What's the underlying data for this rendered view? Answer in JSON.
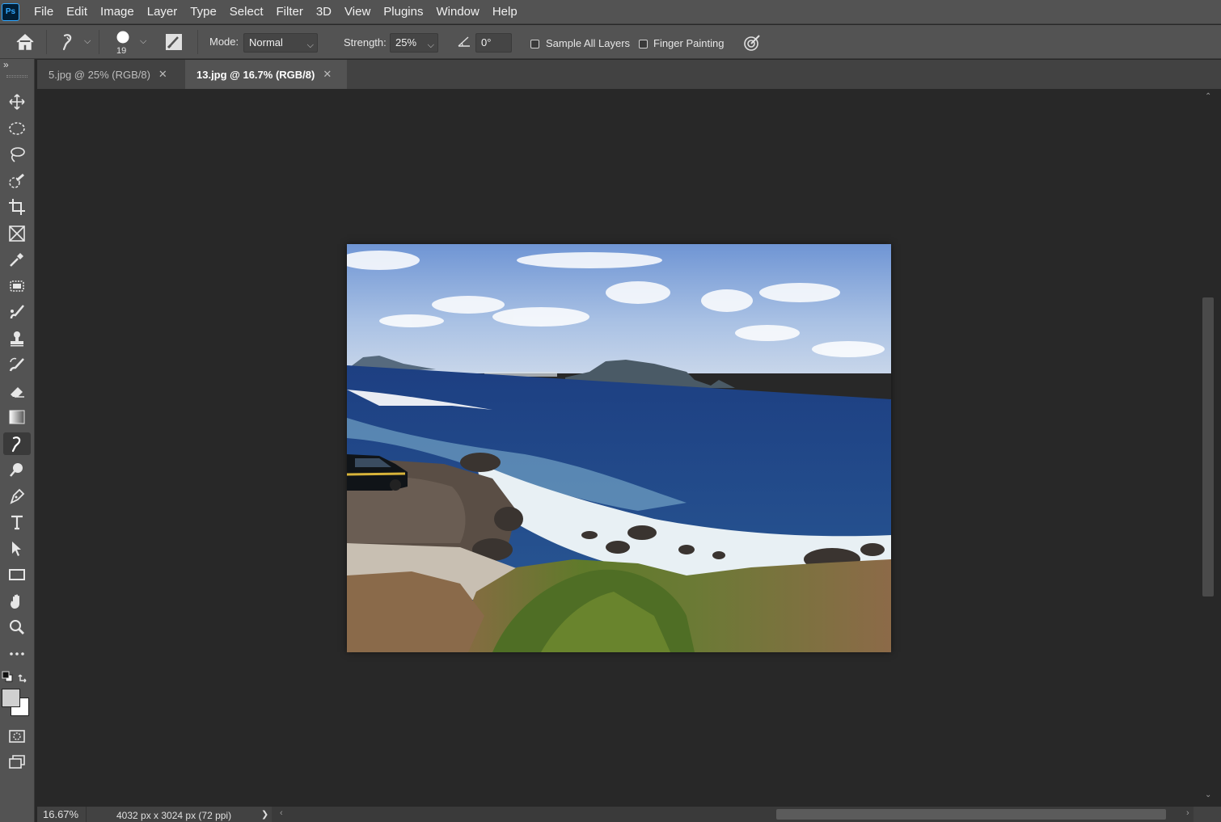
{
  "app": {
    "logo_text": "Ps"
  },
  "menu": [
    "File",
    "Edit",
    "Image",
    "Layer",
    "Type",
    "Select",
    "Filter",
    "3D",
    "View",
    "Plugins",
    "Window",
    "Help"
  ],
  "options": {
    "brush_size": "19",
    "mode_label": "Mode:",
    "mode_value": "Normal",
    "strength_label": "Strength:",
    "strength_value": "25%",
    "angle_value": "0°",
    "sample_all_layers": "Sample All Layers",
    "finger_painting": "Finger Painting"
  },
  "tabs": [
    {
      "label": "5.jpg @ 25% (RGB/8)",
      "active": false
    },
    {
      "label": "13.jpg @ 16.7% (RGB/8)",
      "active": true
    }
  ],
  "toolbar": {
    "expand_glyph": "»",
    "active_tool": "smudge-tool"
  },
  "colors": {
    "foreground": "#d0d0d0",
    "background": "#ffffff",
    "accent": "#31a8ff"
  },
  "status": {
    "zoom": "16.67%",
    "doc_info": "4032 px x 3024 px (72 ppi)",
    "arrow": "❯"
  },
  "document": {
    "description": "coastal landscape photo"
  }
}
